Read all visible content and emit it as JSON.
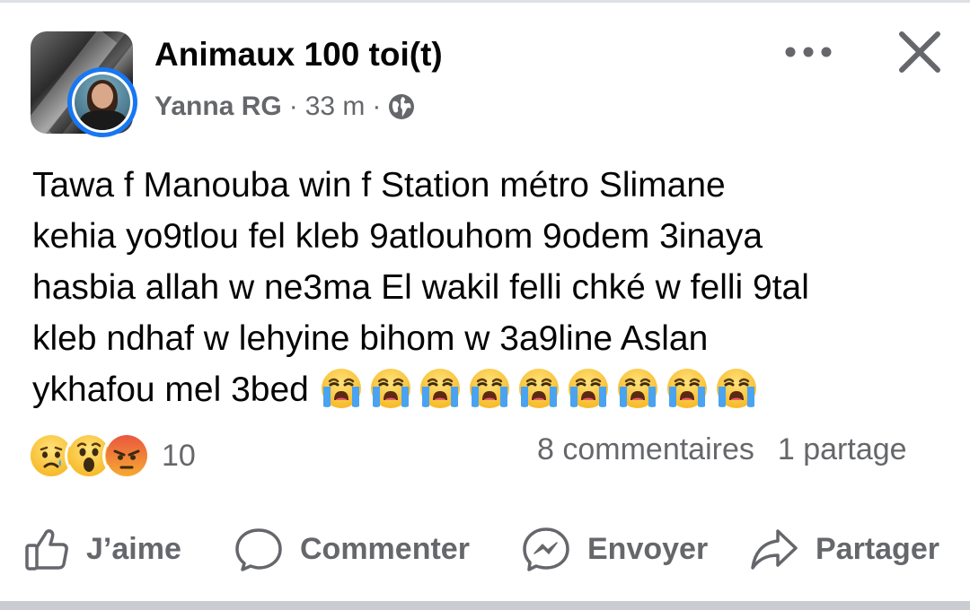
{
  "post": {
    "group_name": "Animaux 100 toi(t)",
    "author": "Yanna RG",
    "time": "33 m",
    "separator": "·",
    "text_lines": [
      "Tawa f Manouba win f Station métro Slimane",
      "kehia yo9tlou fel kleb 9atlouhom 9odem 3inaya",
      "hasbia allah w ne3ma El wakil felli chké w felli 9tal",
      "kleb ndhaf w lehyine bihom w 3a9line Aslan",
      "ykhafou mel 3bed"
    ],
    "emoji": "loudly-crying-face",
    "emoji_count": 9
  },
  "reactions": {
    "types": [
      "sad-face",
      "surprised-face",
      "angry-face"
    ],
    "count": "10",
    "comments": "8 commentaires",
    "shares": "1 partage"
  },
  "actions": {
    "like": "J’aime",
    "comment": "Commenter",
    "send": "Envoyer",
    "share": "Partager"
  },
  "icons": {
    "more": "more-horizontal-icon",
    "close": "close-icon",
    "privacy": "globe-icon"
  },
  "colors": {
    "accent": "#1877f2",
    "secondary_text": "#65676b",
    "primary_text": "#050505"
  }
}
